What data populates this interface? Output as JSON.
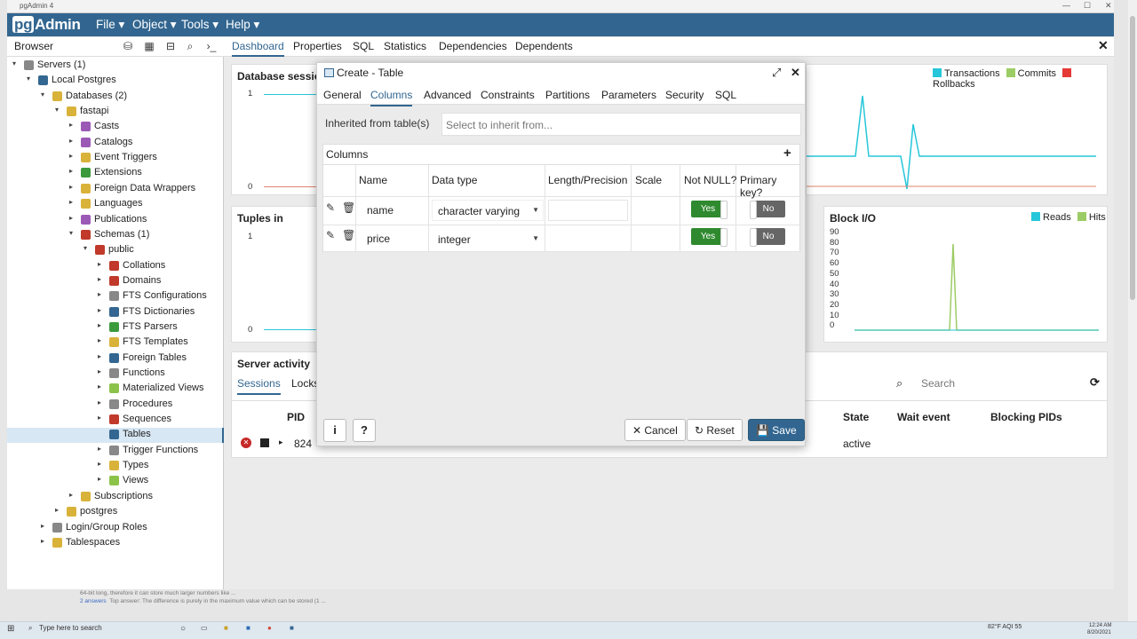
{
  "window": {
    "title": "pgAdmin 4"
  },
  "app": {
    "logo_pg": "pg",
    "logo_rest": "Admin",
    "menus": [
      "File ▾",
      "Object ▾",
      "Tools ▾",
      "Help ▾"
    ]
  },
  "browser": {
    "label": "Browser",
    "tree": [
      {
        "label": "Servers (1)",
        "icon": "servers-icon",
        "color": "#888888",
        "expanded": true
      },
      {
        "label": "Local Postgres",
        "icon": "server-icon",
        "color": "#336791",
        "expanded": true
      },
      {
        "label": "Databases (2)",
        "icon": "databases-icon",
        "color": "#d9b23a",
        "expanded": true
      },
      {
        "label": "fastapi",
        "icon": "database-icon",
        "color": "#d9b23a",
        "expanded": true
      },
      {
        "label": "Casts",
        "icon": "casts-icon",
        "color": "#9b59b6",
        "expanded": false
      },
      {
        "label": "Catalogs",
        "icon": "catalogs-icon",
        "color": "#9b59b6",
        "expanded": false
      },
      {
        "label": "Event Triggers",
        "icon": "event-triggers-icon",
        "color": "#d9b23a",
        "expanded": false
      },
      {
        "label": "Extensions",
        "icon": "extensions-icon",
        "color": "#3c9a3c",
        "expanded": false
      },
      {
        "label": "Foreign Data Wrappers",
        "icon": "fdw-icon",
        "color": "#d9b23a",
        "expanded": false
      },
      {
        "label": "Languages",
        "icon": "languages-icon",
        "color": "#d9b23a",
        "expanded": false
      },
      {
        "label": "Publications",
        "icon": "publications-icon",
        "color": "#9b59b6",
        "expanded": false
      },
      {
        "label": "Schemas (1)",
        "icon": "schemas-icon",
        "color": "#c0392b",
        "expanded": true
      },
      {
        "label": "public",
        "icon": "schema-icon",
        "color": "#c0392b",
        "expanded": true
      },
      {
        "label": "Collations",
        "icon": "collations-icon",
        "color": "#c0392b",
        "expanded": false
      },
      {
        "label": "Domains",
        "icon": "domains-icon",
        "color": "#c0392b",
        "expanded": false
      },
      {
        "label": "FTS Configurations",
        "icon": "fts-configurations-icon",
        "color": "#888888",
        "expanded": false
      },
      {
        "label": "FTS Dictionaries",
        "icon": "fts-dictionaries-icon",
        "color": "#336791",
        "expanded": false
      },
      {
        "label": "FTS Parsers",
        "icon": "fts-parsers-icon",
        "color": "#3c9a3c",
        "expanded": false
      },
      {
        "label": "FTS Templates",
        "icon": "fts-templates-icon",
        "color": "#d9b23a",
        "expanded": false
      },
      {
        "label": "Foreign Tables",
        "icon": "foreign-tables-icon",
        "color": "#336791",
        "expanded": false
      },
      {
        "label": "Functions",
        "icon": "functions-icon",
        "color": "#888888",
        "expanded": false
      },
      {
        "label": "Materialized Views",
        "icon": "materialized-views-icon",
        "color": "#8bc34a",
        "expanded": false
      },
      {
        "label": "Procedures",
        "icon": "procedures-icon",
        "color": "#888888",
        "expanded": false
      },
      {
        "label": "Sequences",
        "icon": "sequences-icon",
        "color": "#c0392b",
        "expanded": false
      },
      {
        "label": "Tables",
        "icon": "tables-icon",
        "color": "#336791",
        "expanded": null
      },
      {
        "label": "Trigger Functions",
        "icon": "trigger-functions-icon",
        "color": "#888888",
        "expanded": false
      },
      {
        "label": "Types",
        "icon": "types-icon",
        "color": "#d9b23a",
        "expanded": false
      },
      {
        "label": "Views",
        "icon": "views-icon",
        "color": "#8bc34a",
        "expanded": false
      },
      {
        "label": "Subscriptions",
        "icon": "subscriptions-icon",
        "color": "#d9b23a",
        "expanded": false
      },
      {
        "label": "postgres",
        "icon": "database-icon",
        "color": "#d9b23a",
        "expanded": false
      },
      {
        "label": "Login/Group Roles",
        "icon": "roles-icon",
        "color": "#888888",
        "expanded": false
      },
      {
        "label": "Tablespaces",
        "icon": "tablespaces-icon",
        "color": "#d9b23a",
        "expanded": false
      }
    ],
    "selected": "Tables"
  },
  "tabs": [
    "Dashboard",
    "Properties",
    "SQL",
    "Statistics",
    "Dependencies",
    "Dependents"
  ],
  "active_tab": "Dashboard",
  "dashboard": {
    "db_sessions_title": "Database session",
    "tx_legend": [
      "Transactions",
      "Commits",
      "Rollbacks"
    ],
    "tx_colors": [
      "#26c6da",
      "#9ccc65",
      "#e53935"
    ],
    "tuples_in_title": "Tuples in",
    "block_io_title": "Block I/O",
    "block_io_legend": [
      "Reads",
      "Hits"
    ],
    "block_io_yticks": [
      "90",
      "80",
      "70",
      "60",
      "50",
      "40",
      "30",
      "20",
      "10",
      "0"
    ],
    "sessions_yticks": [
      "1",
      "0"
    ],
    "tuples_yticks": [
      "1",
      "0"
    ],
    "server_activity_title": "Server activity",
    "activity_tabs": [
      "Sessions",
      "Locks"
    ],
    "search_placeholder": "Search",
    "activity_cols": [
      "PID",
      "State",
      "Wait event",
      "Blocking PIDs"
    ],
    "activity_row": {
      "pid": "824",
      "state": "active"
    }
  },
  "dialog": {
    "title": "Create - Table",
    "tabs": [
      "General",
      "Columns",
      "Advanced",
      "Constraints",
      "Partitions",
      "Parameters",
      "Security",
      "SQL"
    ],
    "active_tab": "Columns",
    "inherit_label": "Inherited from table(s)",
    "inherit_placeholder": "Select to inherit from...",
    "columns_title": "Columns",
    "headers": [
      "Name",
      "Data type",
      "Length/Precision",
      "Scale",
      "Not NULL?",
      "Primary key?"
    ],
    "rows": [
      {
        "name": "name",
        "type": "character varying",
        "length": "",
        "scale": "",
        "not_null": "Yes",
        "pk": "No"
      },
      {
        "name": "price",
        "type": "integer",
        "length": "",
        "scale": "",
        "not_null": "Yes",
        "pk": "No"
      }
    ],
    "buttons": {
      "info": "i",
      "help": "?",
      "cancel": "Cancel",
      "reset": "Reset",
      "save": "Save"
    }
  },
  "background_text": {
    "line1": "64-bit long, therefore it can store much larger numbers like ...",
    "line2_a": "2 answers",
    "line2_b": "Top answer: The difference is purely in the maximum value which can be stored (1 ..."
  },
  "taskbar": {
    "search_placeholder": "Type here to search",
    "weather": "82°F AQI 55",
    "time": "12:24 AM",
    "date": "8/20/2021"
  }
}
